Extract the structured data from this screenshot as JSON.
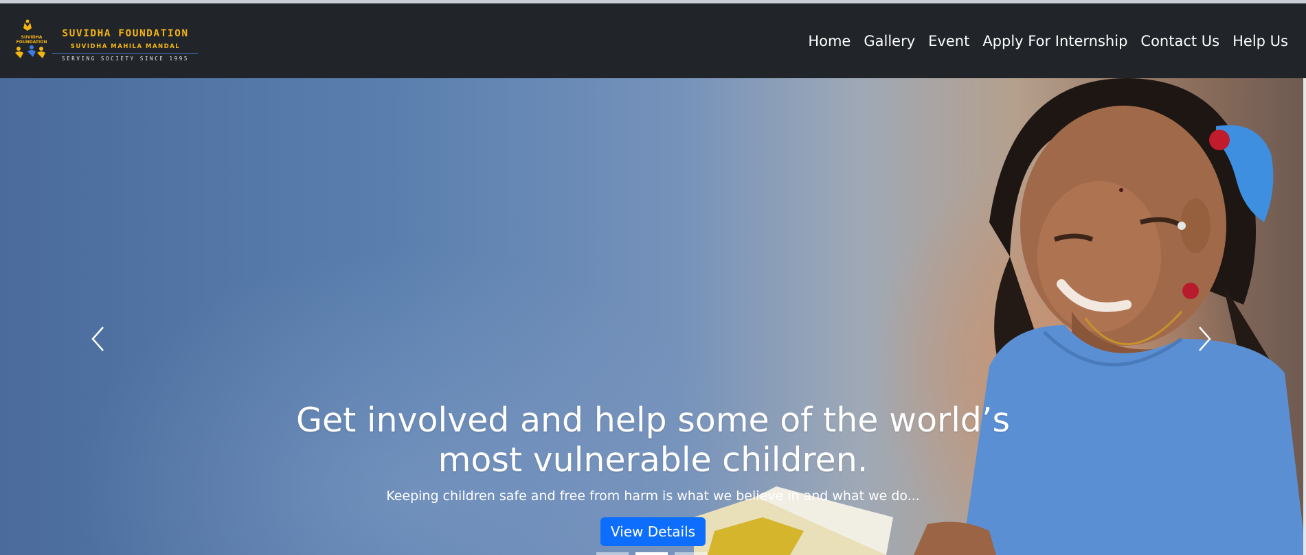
{
  "logo": {
    "mark_text": "SUVIDHA FOUNDATION",
    "title": "SUVIDHA FOUNDATION",
    "subtitle": "SUVIDHA MAHILA MANDAL",
    "tagline": "SERVING SOCIETY SINCE 1995"
  },
  "nav": {
    "items": [
      "Home",
      "Gallery",
      "Event",
      "Apply For Internship",
      "Contact Us",
      "Help Us"
    ]
  },
  "hero": {
    "title": "Get involved and help some of the world’s most vulnerable children.",
    "text": "Keeping children safe and free from harm is what we believe in and what we do...",
    "button_label": "View Details",
    "prev_icon": "chevron-left-icon",
    "next_icon": "chevron-right-icon",
    "slide_count": 3,
    "active_slide": 2
  },
  "colors": {
    "navbar": "#212529",
    "brand_gold": "#f3b414",
    "button": "#0d6efd"
  }
}
